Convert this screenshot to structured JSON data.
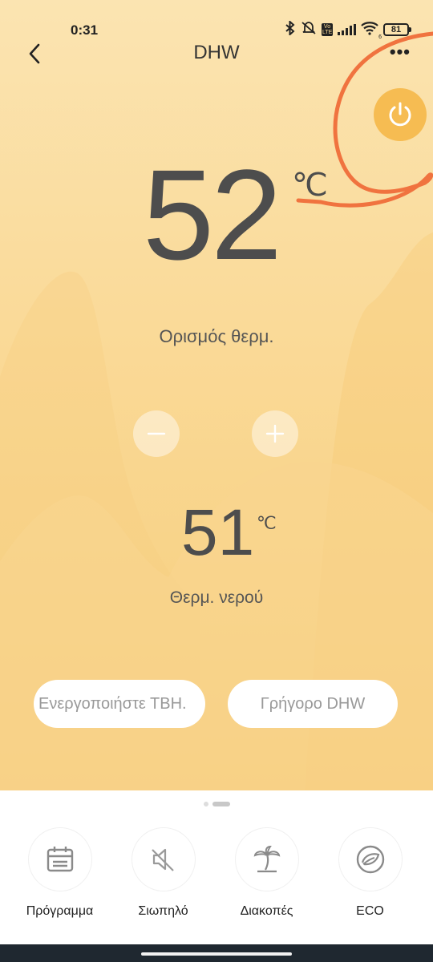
{
  "status_bar": {
    "time": "0:31",
    "battery": "81",
    "volte": "Vo LTE",
    "wifi_sub": "6"
  },
  "header": {
    "title": "DHW",
    "more_glyph": "•••"
  },
  "setpoint": {
    "value": "52",
    "unit": "℃",
    "label": "Ορισμός θερμ."
  },
  "water": {
    "value": "51",
    "unit": "℃",
    "label": "Θερμ. νερού"
  },
  "buttons": {
    "enable_tbh": "Ενεργοποιήστε ΤΒΗ.",
    "fast_dhw": "Γρήγορο DHW"
  },
  "bottom_nav": [
    {
      "label": "Πρόγραμμα",
      "icon": "calendar-icon"
    },
    {
      "label": "Σιωπηλό",
      "icon": "mute-icon"
    },
    {
      "label": "Διακοπές",
      "icon": "palm-tree-icon"
    },
    {
      "label": "ECO",
      "icon": "eco-leaf-icon"
    }
  ],
  "colors": {
    "accent_power": "#f6bc52",
    "annotation": "#f0733f",
    "background_top": "#fbe4b1",
    "background_bottom": "#f6cd7a"
  }
}
